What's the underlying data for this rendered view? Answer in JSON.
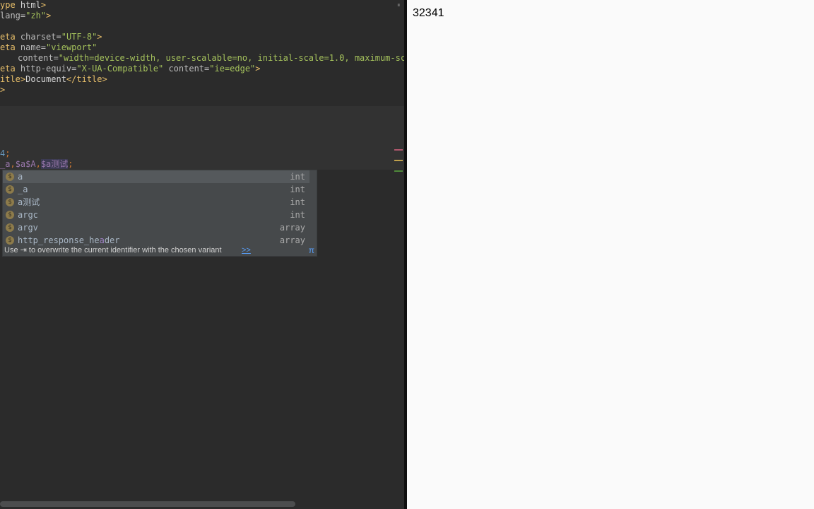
{
  "editor": {
    "lines": {
      "doctype": {
        "tag_open": "ype",
        "text": " html",
        "tag_close": ">"
      },
      "html": {
        "attr": "lang=",
        "val": "\"zh\"",
        "close": ">"
      },
      "meta_charset": {
        "tag": "eta",
        "attr": " charset=",
        "val": "\"UTF-8\"",
        "close": ">"
      },
      "meta_viewport": {
        "tag": "eta",
        "attr": " name=",
        "val": "\"viewport\""
      },
      "content": {
        "attr": "content=",
        "val": "\"width=device-width, user-scalable=no, initial-scale=1.0, maximum-scale"
      },
      "meta_compat": {
        "tag": "eta",
        "attr1": " http-equiv=",
        "val1": "\"X-UA-Compatible\"",
        "attr2": " content=",
        "val2": "\"ie=edge\"",
        "close": ">"
      },
      "title": {
        "tag_open": "itle>",
        "text": "Document",
        "tag_close": "</title>"
      },
      "close_head": ">",
      "num_line": {
        "num": "4",
        "punc": ";"
      },
      "echo_line": {
        "v1": "_a",
        "c1": ",",
        "v2": "$a$A",
        "c2": ",",
        "v3": "$a测试",
        "end": ";"
      }
    }
  },
  "autocomplete": {
    "items": [
      {
        "name": "a",
        "type": "int",
        "icon": "$"
      },
      {
        "name": "_a",
        "type": "int",
        "icon": "$"
      },
      {
        "name": "a测试",
        "type": "int",
        "icon": "$"
      },
      {
        "name": "argc",
        "type": "int",
        "icon": "$"
      },
      {
        "name": "argv",
        "type": "array",
        "icon": "$"
      },
      {
        "name_pre": "http_response_he",
        "name_hl": "a",
        "name_post": "der",
        "type": "array",
        "icon": "$"
      }
    ],
    "footer_hint": "Use ⇥ to overwrite the current identifier with the chosen variant",
    "footer_more": ">>",
    "footer_pi": "π"
  },
  "browser": {
    "content": "32341"
  },
  "colors": {
    "editor_bg": "#2b2b2b",
    "browser_bg": "#fafafa",
    "popup_bg": "#46494b",
    "tag": "#e8bf6a",
    "string": "#a5c25c",
    "variable": "#9876aa"
  }
}
